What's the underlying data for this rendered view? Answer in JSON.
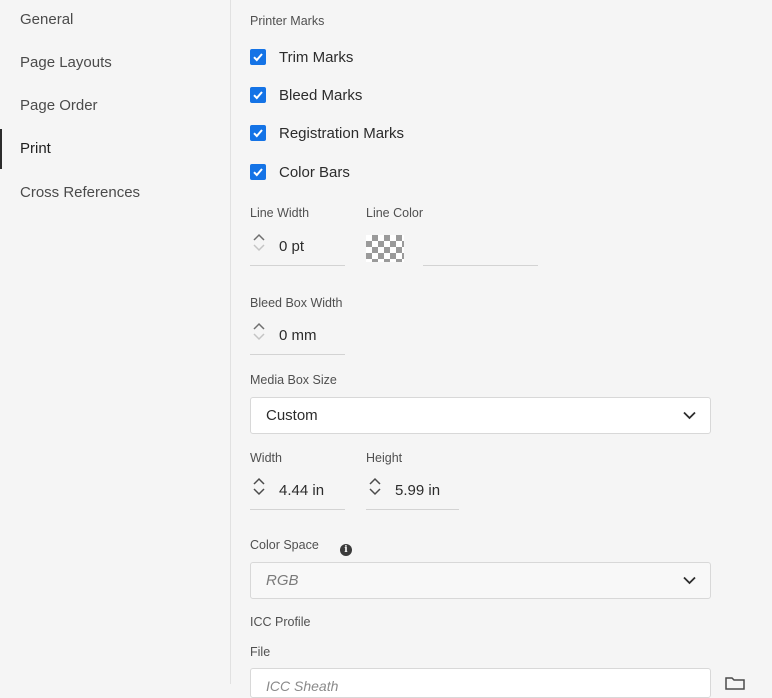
{
  "sidebar": {
    "items": [
      {
        "label": "General",
        "active": false
      },
      {
        "label": "Page Layouts",
        "active": false
      },
      {
        "label": "Page Order",
        "active": false
      },
      {
        "label": "Print",
        "active": true
      },
      {
        "label": "Cross References",
        "active": false
      }
    ]
  },
  "printer_marks": {
    "heading": "Printer Marks",
    "options": [
      {
        "label": "Trim Marks",
        "checked": true
      },
      {
        "label": "Bleed Marks",
        "checked": true
      },
      {
        "label": "Registration Marks",
        "checked": true
      },
      {
        "label": "Color Bars",
        "checked": true
      }
    ]
  },
  "line_width": {
    "label": "Line Width",
    "value": "0 pt"
  },
  "line_color": {
    "label": "Line Color",
    "value": ""
  },
  "bleed_box_width": {
    "label": "Bleed Box Width",
    "value": "0 mm"
  },
  "media_box_size": {
    "label": "Media Box Size",
    "selected": "Custom"
  },
  "width": {
    "label": "Width",
    "value": "4.44 in"
  },
  "height": {
    "label": "Height",
    "value": "5.99 in"
  },
  "color_space": {
    "label": "Color Space",
    "info_icon": "info-icon",
    "selected": "RGB"
  },
  "icc_profile": {
    "label": "ICC Profile",
    "file_label": "File",
    "file_placeholder": "ICC Sheath"
  },
  "colors": {
    "accent": "#1473e6",
    "background": "#f5f5f5"
  }
}
